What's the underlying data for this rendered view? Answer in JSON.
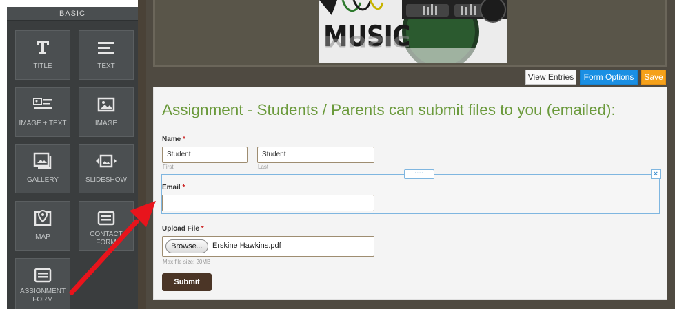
{
  "sidebar": {
    "header": "BASIC",
    "tiles": [
      {
        "label": "TITLE",
        "icon": "title-icon"
      },
      {
        "label": "TEXT",
        "icon": "text-lines-icon"
      },
      {
        "label": "IMAGE + TEXT",
        "icon": "image-text-icon"
      },
      {
        "label": "IMAGE",
        "icon": "image-icon"
      },
      {
        "label": "GALLERY",
        "icon": "gallery-icon"
      },
      {
        "label": "SLIDESHOW",
        "icon": "slideshow-icon"
      },
      {
        "label": "MAP",
        "icon": "map-pin-icon"
      },
      {
        "label": "CONTACT FORM",
        "icon": "form-icon"
      },
      {
        "label": "ASSIGNMENT FORM",
        "icon": "form-icon"
      }
    ]
  },
  "header_image": {
    "text": "MUSIC"
  },
  "toolbar": {
    "view_entries": "View Entries",
    "form_options": "Form Options",
    "save": "Save"
  },
  "form": {
    "title": "Assignment - Students / Parents can submit files to you (emailed):",
    "name_label": "Name",
    "required_mark": "*",
    "first_value": "Student",
    "first_sublabel": "First",
    "last_value": "Student",
    "last_sublabel": "Last",
    "email_label": "Email",
    "email_value": "",
    "upload_label": "Upload File",
    "browse_label": "Browse...",
    "file_name": "Erskine Hawkins.pdf",
    "max_size": "Max file size: 20MB",
    "submit_label": "Submit",
    "drag_handle": "::::",
    "remove_icon": "×"
  },
  "colors": {
    "title_green": "#6b9a3c",
    "form_options_blue": "#1a8fe3",
    "save_orange": "#f5a11a",
    "submit_brown": "#4b3526",
    "arrow_red": "#e8141c"
  }
}
